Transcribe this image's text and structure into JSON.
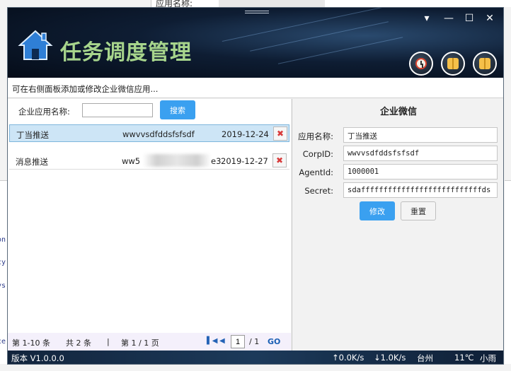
{
  "background": {
    "top_fragment": "应用名称:",
    "left_fragments": [
      "on",
      "cy",
      "ys",
      "ce"
    ]
  },
  "window": {
    "title": "任务调度管理",
    "subtitle": "可在右侧面板添加或修改企业微信应用...",
    "controls": {
      "menu": "▾",
      "minimize": "—",
      "maximize": "☐",
      "close": "✕"
    }
  },
  "search": {
    "label": "企业应用名称:",
    "value": "",
    "placeholder": "",
    "button": "搜索"
  },
  "list": {
    "rows": [
      {
        "name": "丁当推送",
        "corp": "wwvvsdfddsfsfsdf",
        "date": "2019-12-24",
        "selected": true
      },
      {
        "name": "消息推送",
        "corp": "ww5",
        "corp_tail": "e3",
        "date": "2019-12-27",
        "selected": false
      }
    ],
    "delete_glyph": "✖"
  },
  "pager": {
    "range": "第 1-10 条",
    "total": "共 2 条",
    "sep": "|",
    "page": "第 1 / 1 页",
    "page_input": "1",
    "page_total": "/ 1",
    "go": "GO"
  },
  "detail": {
    "title": "企业微信",
    "fields": [
      {
        "label": "应用名称:",
        "value": "丁当推送"
      },
      {
        "label": "CorpID:",
        "value": "wwvvsdfddsfsfsdf"
      },
      {
        "label": "AgentId:",
        "value": "1000001"
      },
      {
        "label": "Secret:",
        "value": "sdafffffffffffffffffffffffffffds"
      }
    ],
    "edit_button": "修改",
    "reset_button": "重置"
  },
  "status": {
    "version": "版本 V1.0.0.0",
    "upload": "↑0.0K/s",
    "download": "↓1.0K/s",
    "city": "台州",
    "temperature": "11℃",
    "weather": "小雨"
  }
}
